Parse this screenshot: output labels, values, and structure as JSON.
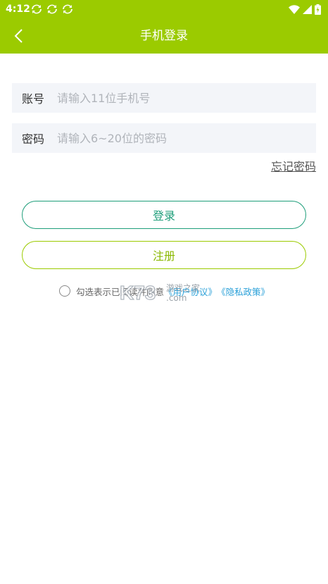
{
  "status_bar": {
    "time": "4:12"
  },
  "header": {
    "title": "手机登录"
  },
  "form": {
    "account_label": "账号",
    "account_placeholder": "请输入11位手机号",
    "password_label": "密码",
    "password_placeholder": "请输入6~20位的密码",
    "forgot_label": "忘记密码"
  },
  "buttons": {
    "login_label": "登录",
    "register_label": "注册"
  },
  "agreement": {
    "text": "勾选表示已阅读并同意",
    "user_agreement": "《用户协议》",
    "privacy_policy": "《隐私政策》"
  },
  "watermark": {
    "brand": "K73",
    "tagline": "游戏之家",
    "domain": ".com"
  },
  "colors": {
    "header_bg": "#9bcb00",
    "login_border": "#1e9e7a",
    "register_border": "#9bcb00",
    "link": "#2aa0d8"
  }
}
